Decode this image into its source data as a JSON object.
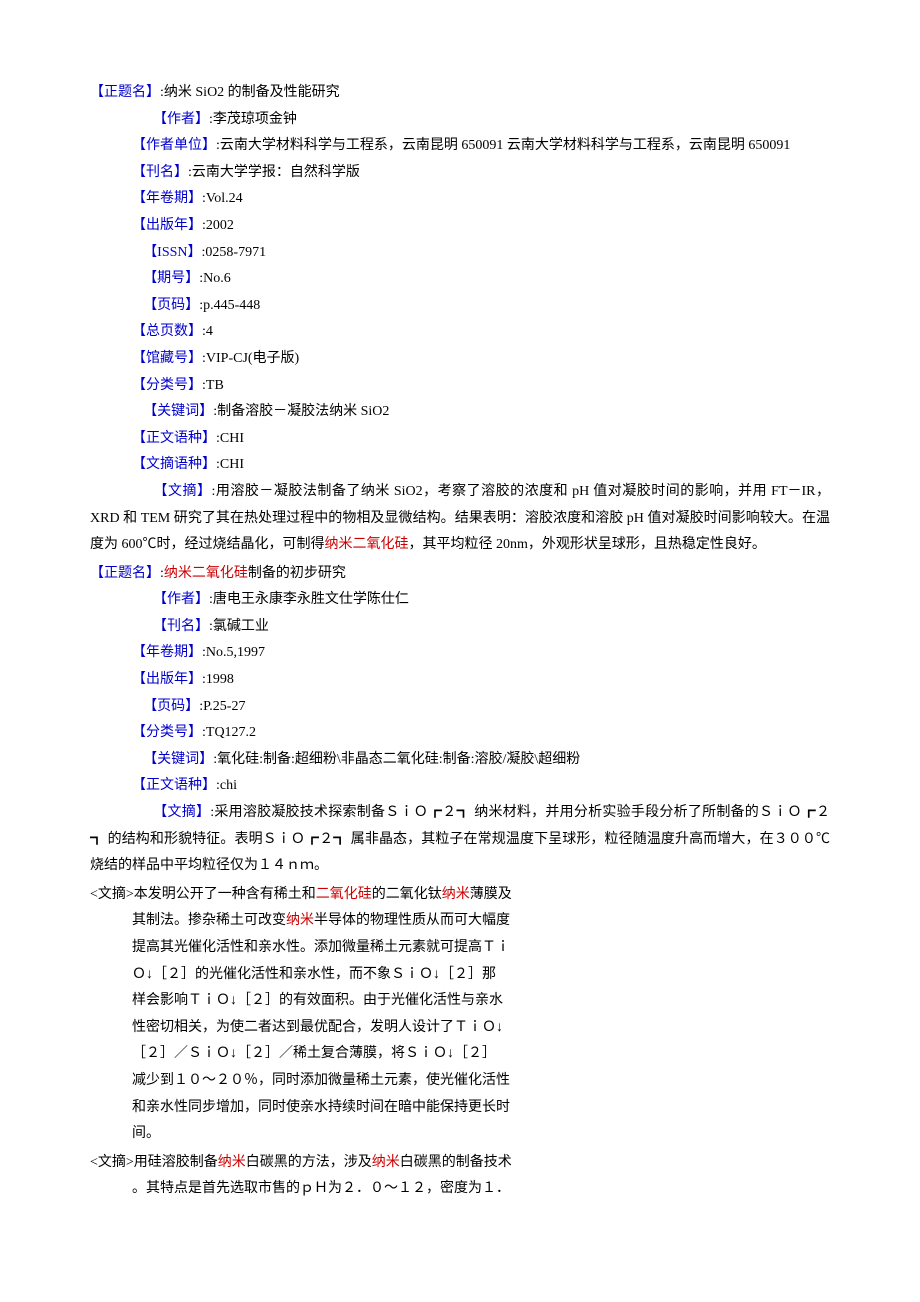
{
  "record1": {
    "title_label": "【正题名】",
    "title_value": ":纳米 SiO2 的制备及性能研究",
    "author_label": "【作者】",
    "author_value": ":李茂琼项金钟",
    "affiliation_label": "【作者单位】",
    "affiliation_value": ":云南大学材料科学与工程系，云南昆明 650091 云南大学材料科学与工程系，云南昆明 650091",
    "journal_label": "【刊名】",
    "journal_value": ":云南大学学报：自然科学版",
    "volume_label": "【年卷期】",
    "volume_value": ":Vol.24",
    "pubyear_label": "【出版年】",
    "pubyear_value": ":2002",
    "issn_label": "【ISSN】",
    "issn_value": ":0258-7971",
    "issue_label": "【期号】",
    "issue_value": ":No.6",
    "pages_label": "【页码】",
    "pages_value": ":p.445-448",
    "totalpages_label": "【总页数】",
    "totalpages_value": ":4",
    "collection_label": "【馆藏号】",
    "collection_value": ":VIP-CJ(电子版)",
    "classno_label": "【分类号】",
    "classno_value": ":TB",
    "keywords_label": "【关键词】",
    "keywords_value": ":制备溶胶－凝胶法纳米 SiO2",
    "textlang_label": "【正文语种】",
    "textlang_value": ":CHI",
    "abstlang_label": "【文摘语种】",
    "abstlang_value": ":CHI",
    "abstract_label": "【文摘】",
    "abstract_p1a": ":用溶胶－凝胶法制备了纳米 SiO2，考察了溶胶的浓度和 pH 值对凝胶时间的影响，并用 FT－IR，XRD 和 TEM 研究了其在热处理过程中的物相及显微结构。结果表明：溶胶浓度和溶胶 pH 值对凝胶时间影响较大。在温度为 600℃时，经过烧结晶化，可制得",
    "abstract_hl": "纳米二氧化硅",
    "abstract_p1b": "，其平均粒径 20nm，外观形状呈球形，且热稳定性良好。"
  },
  "record2": {
    "title_label": "【正题名】",
    "title_a": ":",
    "title_hl": "纳米二氧化硅",
    "title_b": "制备的初步研究",
    "author_label": "【作者】",
    "author_value": ":唐电王永康李永胜文仕学陈仕仁",
    "journal_label": "【刊名】",
    "journal_value": ":氯碱工业",
    "volume_label": "【年卷期】",
    "volume_value": ":No.5,1997",
    "pubyear_label": "【出版年】",
    "pubyear_value": ":1998",
    "pages_label": "【页码】",
    "pages_value": ":P.25-27",
    "classno_label": "【分类号】",
    "classno_value": ":TQ127.2",
    "keywords_label": "【关键词】",
    "keywords_value": ":氧化硅:制备:超细粉\\非晶态二氧化硅:制备:溶胶/凝胶\\超细粉",
    "textlang_label": "【正文语种】",
    "textlang_value": ":chi",
    "abstract_label": "【文摘】",
    "abstract_value": ":采用溶胶凝胶技术探索制备ＳｉＯ┏２┓ 纳米材料，并用分析实验手段分析了所制备的ＳｉＯ┏２┓ 的结构和形貌特征。表明ＳｉＯ┏２┓ 属非晶态，其粒子在常规温度下呈球形，粒径随温度升高而增大，在３００℃烧结的样品中平均粒径仅为１４ｎｍ。"
  },
  "record3": {
    "head_a": "<文摘>本发明公开了一种含有稀土和",
    "head_hl1": "二氧化硅",
    "head_b": "的二氧化钛",
    "head_hl2": "纳米",
    "head_c": "薄膜及",
    "l1a": "其制法。掺杂稀土可改变",
    "l1hl": "纳米",
    "l1b": "半导体的物理性质从而可大幅度",
    "l2": "提高其光催化活性和亲水性。添加微量稀土元素就可提高Ｔｉ",
    "l3": "Ｏ↓［２］的光催化活性和亲水性，而不象ＳｉＯ↓［２］那",
    "l4": "样会影响ＴｉＯ↓［２］的有效面积。由于光催化活性与亲水",
    "l5": "性密切相关，为使二者达到最优配合，发明人设计了ＴｉＯ↓",
    "l6": "［２］／ＳｉＯ↓［２］／稀土复合薄膜，将ＳｉＯ↓［２］",
    "l7": "减少到１０～２０％，同时添加微量稀土元素，使光催化活性",
    "l8": "和亲水性同步增加，同时使亲水持续时间在暗中能保持更长时",
    "l9": "间。"
  },
  "record4": {
    "head_a": "<文摘>用硅溶胶制备",
    "head_hl1": "纳米",
    "head_b": "白碳黑的方法，涉及",
    "head_hl2": "纳米",
    "head_c": "白碳黑的制备技术",
    "l1": "。其特点是首先选取市售的ｐＨ为２．０～１２，密度为１．"
  }
}
